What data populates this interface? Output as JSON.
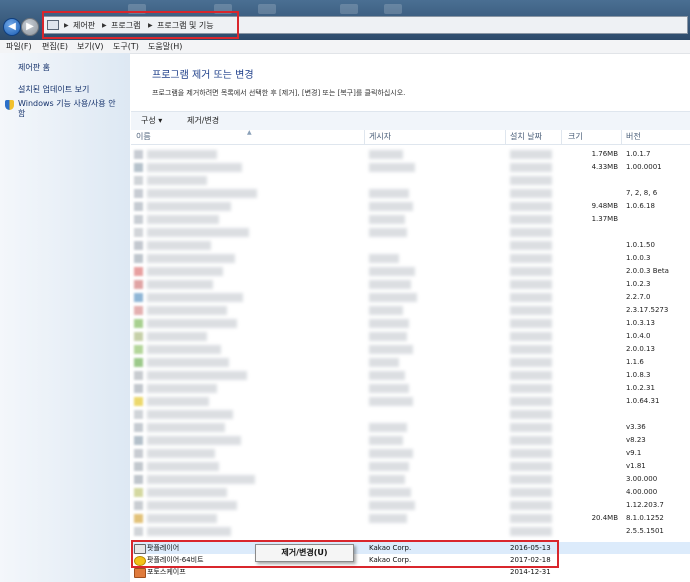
{
  "breadcrumbs": [
    "제어판",
    "프로그램",
    "프로그램 및 기능"
  ],
  "menu": [
    "파일(F)",
    "편집(E)",
    "보기(V)",
    "도구(T)",
    "도움말(H)"
  ],
  "sidebar": {
    "links": [
      "제어판 홈",
      "설치된 업데이트 보기",
      "Windows 기능 사용/사용 안",
      "함"
    ]
  },
  "main": {
    "title": "프로그램 제거 또는 변경",
    "description": "프로그램을 제거하려면 목록에서 선택한 후 [제거], [변경] 또는 [복구]를 클릭하십시오."
  },
  "toolbar": {
    "organize": "구성 ▾",
    "uninstall_change": "제거/변경"
  },
  "columns": {
    "name": "이름",
    "publisher": "게시자",
    "installed_on": "설치 날짜",
    "size": "크기",
    "version": "버전"
  },
  "rows": [
    {
      "size": "1.76MB",
      "version": "1.0.1.7",
      "icon": "#c7ccd3"
    },
    {
      "size": "4.33MB",
      "version": "1.00.0001",
      "icon": "#b6c2cc"
    },
    {
      "size": "",
      "version": "",
      "icon": "#d0d4d8"
    },
    {
      "size": "",
      "version": "7, 2, 8, 6",
      "icon": "#c7ccd3"
    },
    {
      "size": "9.48MB",
      "version": "1.0.6.18",
      "icon": "#c5cbd2"
    },
    {
      "size": "1.37MB",
      "version": "",
      "icon": "#c9ced4"
    },
    {
      "size": "",
      "version": "",
      "icon": "#d2d5d9"
    },
    {
      "size": "",
      "version": "1.0.1.50",
      "icon": "#c3c8cf"
    },
    {
      "size": "",
      "version": "1.0.0.3",
      "icon": "#bfc6cd"
    },
    {
      "size": "",
      "version": "2.0.0.3 Beta",
      "icon": "#e8a0a0"
    },
    {
      "size": "",
      "version": "1.0.2.3",
      "icon": "#e0a3a3"
    },
    {
      "size": "",
      "version": "2.2.7.0",
      "icon": "#8fb6d6"
    },
    {
      "size": "",
      "version": "2.3.17.5273",
      "icon": "#e4b0b0"
    },
    {
      "size": "",
      "version": "1.0.3.13",
      "icon": "#a7d08f"
    },
    {
      "size": "",
      "version": "1.0.4.0",
      "icon": "#c6d0a8"
    },
    {
      "size": "",
      "version": "2.0.0.13",
      "icon": "#b4d69a"
    },
    {
      "size": "",
      "version": "1.1.6",
      "icon": "#9cc98a"
    },
    {
      "size": "",
      "version": "1.0.8.3",
      "icon": "#c8ccd0"
    },
    {
      "size": "",
      "version": "1.0.2.31",
      "icon": "#c2c7cd"
    },
    {
      "size": "",
      "version": "1.0.64.31",
      "icon": "#ecd86c"
    },
    {
      "size": "",
      "version": "",
      "icon": "#d0d4d8"
    },
    {
      "size": "",
      "version": "v3.36",
      "icon": "#c5cbd1"
    },
    {
      "size": "",
      "version": "v8.23",
      "icon": "#b4c0ca"
    },
    {
      "size": "",
      "version": "v9.1",
      "icon": "#c8ccd2"
    },
    {
      "size": "",
      "version": "v1.81",
      "icon": "#c2c8ce"
    },
    {
      "size": "",
      "version": "3.00.000",
      "icon": "#bfc5cc"
    },
    {
      "size": "",
      "version": "4.00.000",
      "icon": "#d4d8a0"
    },
    {
      "size": "",
      "version": "1.12.203.7",
      "icon": "#c9cdd2"
    },
    {
      "size": "20.4MB",
      "version": "8.1.0.1252",
      "icon": "#e2c27a"
    },
    {
      "size": "",
      "version": "2.5.5.1501",
      "icon": "#d1d5d9"
    }
  ],
  "visible_rows": [
    {
      "name": "팟플레이어",
      "publisher": "Kakao Corp.",
      "date": "2016-05-13",
      "selected": true
    },
    {
      "name": "팟플레이어-64비트",
      "publisher": "Kakao Corp.",
      "date": "2017-02-18",
      "selected": false
    },
    {
      "name": "포토스케이프",
      "publisher": "",
      "date": "2014-12-31",
      "selected": false
    }
  ],
  "context_menu": {
    "uninstall_change": "제거/변경(U)"
  },
  "colors": {
    "highlight_border": "#d9262c",
    "link_blue": "#14316b",
    "title_blue": "#1e3f8a"
  }
}
